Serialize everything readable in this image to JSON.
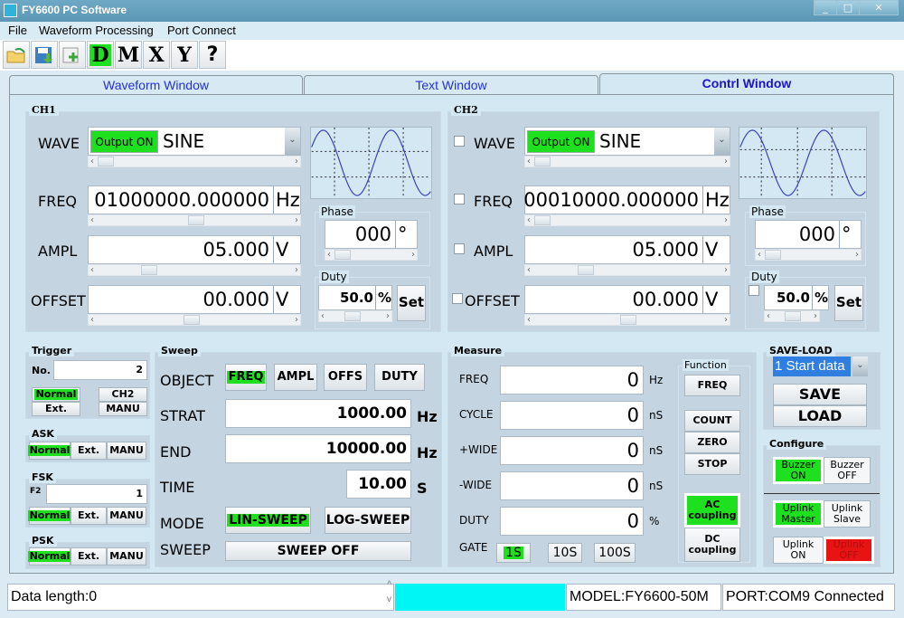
{
  "window": {
    "title": "FY6600 PC Software",
    "minimize": "_",
    "maximize": "□",
    "close": "✕"
  },
  "menu": [
    "File",
    "Waveform Processing",
    "Port Connect"
  ],
  "toolbar": {
    "open": "open-folder",
    "save": "save-disk",
    "add": "add-file",
    "d": "D",
    "m": "M",
    "x": "X",
    "y": "Y",
    "help": "?"
  },
  "tabs": [
    "Waveform Window",
    "Text Window",
    "Contrl Window"
  ],
  "ch1": {
    "label": "CH1",
    "wave_label": "WAVE",
    "output": "Output ON",
    "wave": "SINE",
    "freq_label": "FREQ",
    "freq": "01000000.000000",
    "freq_unit": "Hz",
    "ampl_label": "AMPL",
    "ampl": "05.000",
    "ampl_unit": "V",
    "offset_label": "OFFSET",
    "offset": "00.000",
    "offset_unit": "V",
    "phase_label": "Phase",
    "phase": "000",
    "phase_unit": "°",
    "duty_label": "Duty",
    "duty": "50.0",
    "duty_unit": "%",
    "set": "Set"
  },
  "ch2": {
    "label": "CH2",
    "wave_label": "WAVE",
    "output": "Output ON",
    "wave": "SINE",
    "freq_label": "FREQ",
    "freq": "00010000.000000",
    "freq_unit": "Hz",
    "ampl_label": "AMPL",
    "ampl": "05.000",
    "ampl_unit": "V",
    "offset_label": "OFFSET",
    "offset": "00.000",
    "offset_unit": "V",
    "phase_label": "Phase",
    "phase": "000",
    "phase_unit": "°",
    "duty_label": "Duty",
    "duty": "50.0",
    "duty_unit": "%",
    "set": "Set"
  },
  "trigger": {
    "label": "Trigger",
    "no_label": "No.",
    "no": "2",
    "normal": "Normal",
    "ext": "Ext.",
    "ch2": "CH2",
    "manu": "MANU"
  },
  "ask": {
    "label": "ASK",
    "normal": "Normal",
    "ext": "Ext.",
    "manu": "MANU"
  },
  "fsk": {
    "label": "FSK",
    "f2_label": "F2",
    "f2": "1",
    "normal": "Normal",
    "ext": "Ext.",
    "manu": "MANU"
  },
  "psk": {
    "label": "PSK",
    "normal": "Normal",
    "ext": "Ext.",
    "manu": "MANU"
  },
  "sweep": {
    "label": "Sweep",
    "object_label": "OBJECT",
    "objects": [
      "FREQ",
      "AMPL",
      "OFFS",
      "DUTY"
    ],
    "start_label": "STRAT",
    "start": "1000.00",
    "start_unit": "Hz",
    "end_label": "END",
    "end": "10000.00",
    "end_unit": "Hz",
    "time_label": "TIME",
    "time": "10.00",
    "time_unit": "S",
    "mode_label": "MODE",
    "lin": "LIN-SWEEP",
    "log": "LOG-SWEEP",
    "sweep_label": "SWEEP",
    "sweep_btn": "SWEEP  OFF"
  },
  "measure": {
    "label": "Measure",
    "rows": [
      {
        "label": "FREQ",
        "value": "0",
        "unit": "Hz"
      },
      {
        "label": "CYCLE",
        "value": "0",
        "unit": "nS"
      },
      {
        "label": "+WIDE",
        "value": "0",
        "unit": "nS"
      },
      {
        "label": "-WIDE",
        "value": "0",
        "unit": "nS"
      },
      {
        "label": "DUTY",
        "value": "0",
        "unit": "%"
      }
    ],
    "gate_label": "GATE",
    "gates": [
      "1S",
      "10S",
      "100S"
    ],
    "function_label": "Function",
    "freq": "FREQ",
    "count": "COUNT",
    "zero": "ZERO",
    "stop": "STOP",
    "ac": "AC coupling",
    "dc": "DC coupling"
  },
  "saveload": {
    "label": "SAVE-LOAD",
    "selected": "1 Start data",
    "save": "SAVE",
    "load": "LOAD"
  },
  "configure": {
    "label": "Configure",
    "buzzer_on": "Buzzer ON",
    "buzzer_off": "Buzzer OFF",
    "uplink_master": "Uplink Master",
    "uplink_slave": "Uplink Slave",
    "uplink_on": "Uplink ON",
    "uplink_off": "Uplink OFF"
  },
  "status": {
    "data_length": "Data length:0",
    "model": "MODEL:FY6600-50M",
    "port": "PORT:COM9 Connected"
  },
  "colors": {
    "active": "#1ee01e",
    "alert": "#e81414",
    "indicator": "#00f5f5"
  }
}
